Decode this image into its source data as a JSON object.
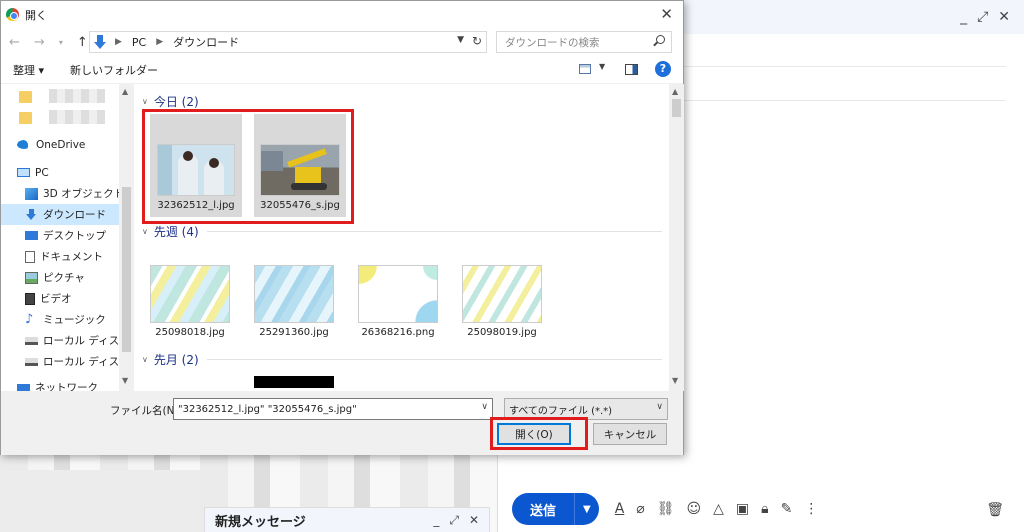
{
  "dialog": {
    "title": "開く",
    "address": {
      "crumbs": [
        "PC",
        "ダウンロード"
      ]
    },
    "search": {
      "placeholder": "ダウンロードの検索"
    },
    "commands": {
      "organize": "整理 ▾",
      "new_folder": "新しいフォルダー"
    },
    "help": "?",
    "nav": {
      "onedrive": "OneDrive",
      "pc": "PC",
      "items": [
        "3D オブジェクト",
        "ダウンロード",
        "デスクトップ",
        "ドキュメント",
        "ピクチャ",
        "ビデオ",
        "ミュージック",
        "ローカル ディスク (C",
        "ローカル ディスク (D",
        "ネットワーク"
      ]
    },
    "groups": [
      {
        "label": "今日 (2)"
      },
      {
        "label": "先週 (4)"
      },
      {
        "label": "先月 (2)"
      }
    ],
    "files": {
      "today": [
        "32362512_l.jpg",
        "32055476_s.jpg"
      ],
      "last_week": [
        "25098018.jpg",
        "25291360.jpg",
        "26368216.png",
        "25098019.jpg"
      ]
    },
    "filename_label": "ファイル名(N):",
    "filename_value": "\"32362512_l.jpg\" \"32055476_s.jpg\"",
    "filetype": "すべてのファイル (*.*)",
    "open_button": "開く(O)",
    "cancel_button": "キャンセル"
  },
  "compose": {
    "send": "送信",
    "mini_title": "新規メッセージ"
  },
  "colors": {
    "highlight": "#e01c1c",
    "accent": "#0b57d0",
    "selection": "#cce8ff"
  }
}
